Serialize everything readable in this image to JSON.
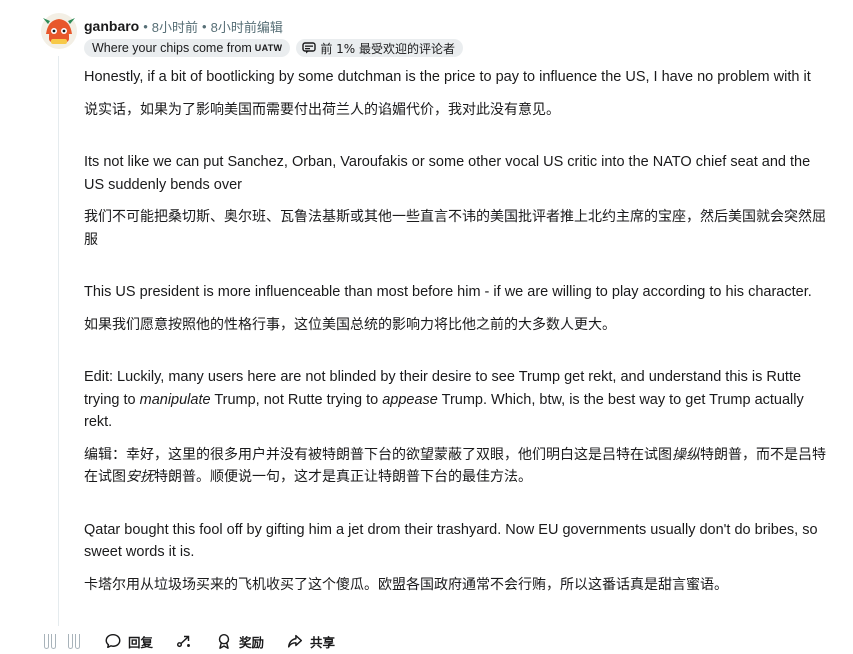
{
  "comment": {
    "author": "ganbaro",
    "time": "8小时前",
    "edited": "8小时前编辑",
    "separator": "•",
    "flair_text": "Where your chips come from",
    "flair_suffix": "UATW",
    "top_commenter_badge": "前 1% 最受欢迎的评论者",
    "paragraphs": [
      {
        "en": "Honestly, if a bit of bootlicking by some dutchman is the price to pay to influence the US, I have no problem with it",
        "zh": "说实话，如果为了影响美国而需要付出荷兰人的谄媚代价，我对此没有意见。"
      },
      {
        "en": "Its not like we can put Sanchez, Orban, Varoufakis or some other vocal US critic into the NATO chief seat and the US suddenly bends over",
        "zh": "我们不可能把桑切斯、奥尔班、瓦鲁法基斯或其他一些直言不讳的美国批评者推上北约主席的宝座，然后美国就会突然屈服"
      },
      {
        "en": "This US president is more influenceable than most before him - if we are willing to play according to his character.",
        "zh": "如果我们愿意按照他的性格行事，这位美国总统的影响力将比他之前的大多数人更大。"
      },
      {
        "en_parts": [
          "Edit: Luckily, many users here are not blinded by their desire to see Trump get rekt, and understand this is Rutte trying to ",
          "manipulate",
          " Trump, not Rutte trying to ",
          "appease",
          " Trump. Which, btw, is the best way to get Trump actually rekt."
        ],
        "zh_parts": [
          "编辑：幸好，这里的很多用户并没有被特朗普下台的欲望蒙蔽了双眼，他们明白这是吕特在试图",
          "操纵",
          "特朗普，而不是吕特在试图",
          "安抚",
          "特朗普。顺便说一句，这才是真正让特朗普下台的最佳方法。"
        ]
      },
      {
        "en": "Qatar bought this fool off by gifting him a jet drom their trashyard. Now EU governments usually don't do bribes, so sweet words it is.",
        "zh": "卡塔尔用从垃圾场买来的飞机收买了这个傻瓜。欧盟各国政府通常不会行贿，所以这番话真是甜言蜜语。"
      }
    ]
  },
  "actions": {
    "reply": "回复",
    "award": "奖励",
    "share": "共享"
  },
  "icons": {
    "upvote": "upvote-icon",
    "downvote": "downvote-icon",
    "reply": "comment-bubble-icon",
    "forward": "forward-icon",
    "award": "award-icon",
    "share": "share-icon",
    "top_commenter": "top-commenter-icon"
  },
  "colors": {
    "meta": "#576f76",
    "flair_bg": "#eaedef",
    "avatar_primary": "#e8572a",
    "avatar_secondary": "#2e8b57"
  }
}
